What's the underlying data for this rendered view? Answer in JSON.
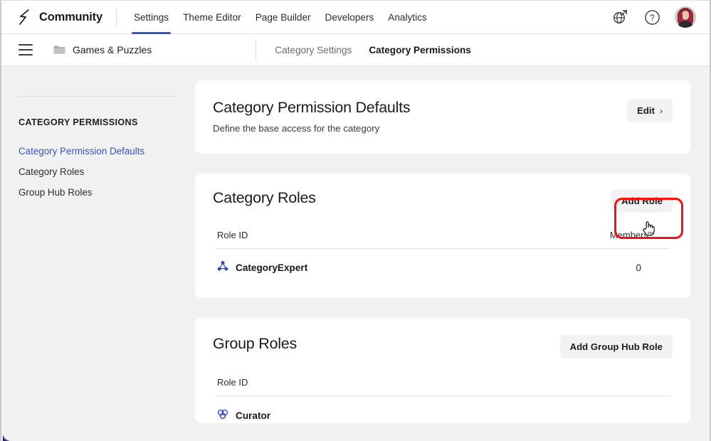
{
  "topnav": {
    "logo_icon": "community-logo-icon",
    "brand": "Community",
    "tabs": [
      {
        "label": "Settings",
        "active": true
      },
      {
        "label": "Theme Editor",
        "active": false
      },
      {
        "label": "Page Builder",
        "active": false
      },
      {
        "label": "Developers",
        "active": false
      },
      {
        "label": "Analytics",
        "active": false
      }
    ],
    "active_tab_underline_color": "#3b53c4",
    "right_icons": [
      {
        "name": "globe-external-link-icon"
      },
      {
        "name": "help-question-icon"
      },
      {
        "name": "user-avatar"
      }
    ]
  },
  "subnav": {
    "menu_icon": "hamburger-menu-icon",
    "folder_icon": "folder-icon",
    "breadcrumb": "Games & Puzzles",
    "tabs": [
      {
        "label": "Category Settings",
        "active": false
      },
      {
        "label": "Category Permissions",
        "active": true
      }
    ]
  },
  "sidebar": {
    "section_title": "CATEGORY PERMISSIONS",
    "items": [
      {
        "label": "Category Permission Defaults",
        "active": true
      },
      {
        "label": "Category Roles",
        "active": false
      },
      {
        "label": "Group Hub Roles",
        "active": false
      }
    ],
    "active_color": "#3b53c4"
  },
  "cards": {
    "permission_defaults": {
      "title": "Category Permission Defaults",
      "subtitle": "Define the base access for the category",
      "edit_label": "Edit",
      "edit_chevron": "›"
    },
    "category_roles": {
      "title": "Category Roles",
      "add_label": "Add Role",
      "columns": {
        "role_id": "Role ID",
        "members": "Members"
      },
      "rows": [
        {
          "icon": "role-network-icon",
          "name": "CategoryExpert",
          "members": "0"
        }
      ]
    },
    "group_roles": {
      "title": "Group Roles",
      "add_label": "Add Group Hub Role",
      "columns": {
        "role_id": "Role ID"
      },
      "rows": [
        {
          "icon": "role-group-icon",
          "name": "Curator"
        }
      ]
    }
  },
  "annotation": {
    "highlight_target": "add-role-button",
    "highlight_color": "#fb0f0f",
    "cursor_type": "pointer-hand"
  }
}
